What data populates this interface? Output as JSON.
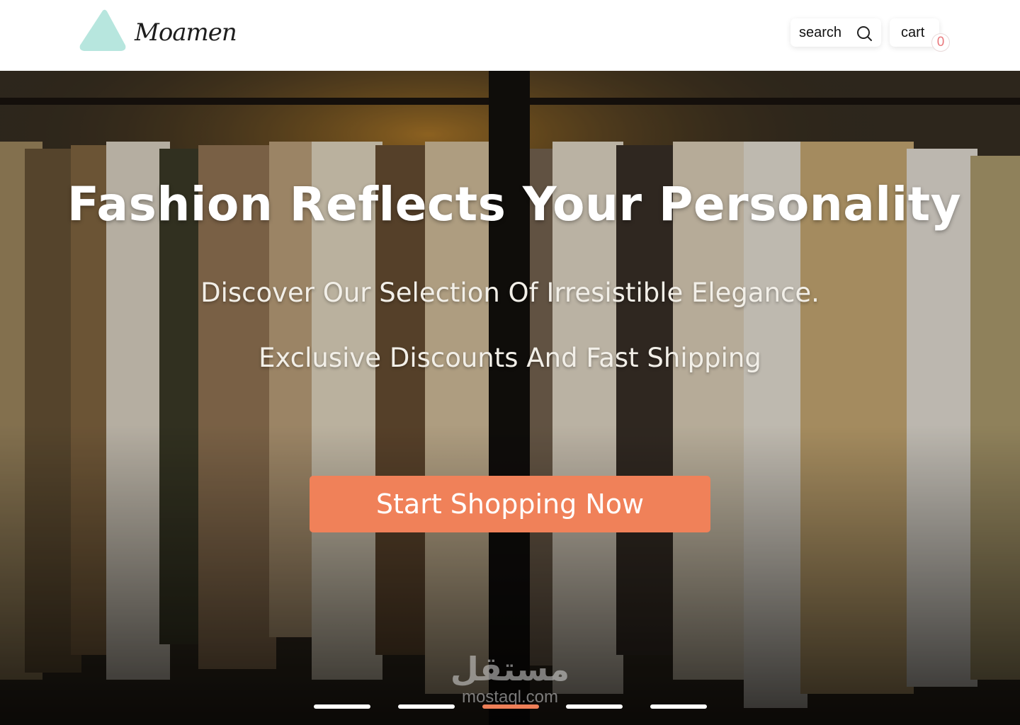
{
  "brand": {
    "name": "Moamen",
    "logo_color": "#b7e6de"
  },
  "header": {
    "search_label": "search",
    "search_icon": "search-icon",
    "cart_label": "cart",
    "cart_count": "0"
  },
  "hero": {
    "title": "Fashion Reflects Your Personality",
    "subtitle_1": "Discover Our Selection Of Irresistible Elegance.",
    "subtitle_2": "Exclusive Discounts And Fast Shipping",
    "cta_label": "Start Shopping Now",
    "cta_color": "#f08159",
    "background": "clothing-rack-photo"
  },
  "slider": {
    "count": 5,
    "active_index": 2,
    "active_color": "#ee7f58"
  },
  "watermark": {
    "arabic": "مستقل",
    "latin": "mostaql.com"
  }
}
